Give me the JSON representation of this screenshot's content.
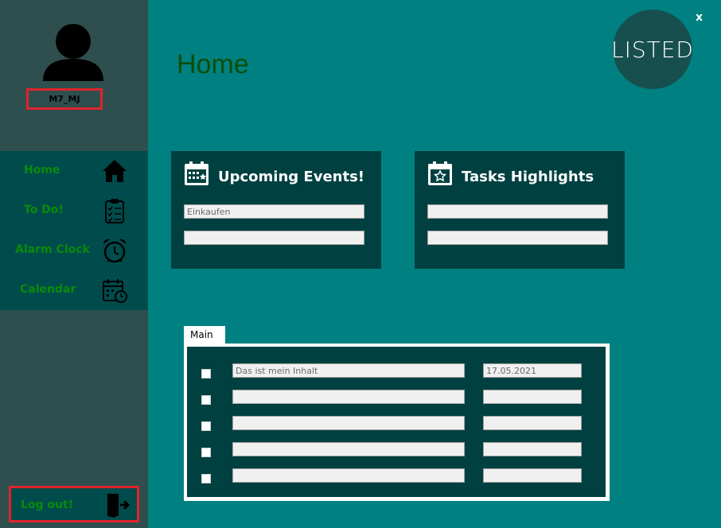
{
  "user": {
    "name": "M7_MJ"
  },
  "nav": {
    "items": [
      {
        "label": "Home",
        "icon": "home-icon"
      },
      {
        "label": "To Do!",
        "icon": "clipboard-checklist-icon"
      },
      {
        "label": "Alarm Clock",
        "icon": "alarm-clock-icon"
      },
      {
        "label": "Calendar",
        "icon": "calendar-clock-icon"
      }
    ]
  },
  "logout": {
    "label": "Log out!",
    "icon": "exit-door-icon"
  },
  "window": {
    "close_label": "x"
  },
  "logo": {
    "text": "LISTED"
  },
  "page": {
    "title": "Home"
  },
  "upcoming_events": {
    "title": "Upcoming Events!",
    "icon": "calendar-star-icon",
    "fields": [
      "Einkaufen",
      ""
    ]
  },
  "tasks_highlights": {
    "title": "Tasks Highlights",
    "icon": "calendar-star-icon",
    "fields": [
      "",
      ""
    ]
  },
  "tabs": [
    {
      "label": "Main"
    }
  ],
  "task_rows": [
    {
      "checked": false,
      "content": "Das ist mein Inhalt",
      "date": "17.05.2021"
    },
    {
      "checked": false,
      "content": "",
      "date": ""
    },
    {
      "checked": false,
      "content": "",
      "date": ""
    },
    {
      "checked": false,
      "content": "",
      "date": ""
    },
    {
      "checked": false,
      "content": "",
      "date": ""
    }
  ],
  "colors": {
    "background": "#008080",
    "sidebar": "#2f4f4f",
    "nav_background": "#004c4c",
    "card_background": "#004040",
    "nav_text": "#0a8a0a",
    "title_text": "#0b4d0b",
    "highlight_border": "#e0242c"
  }
}
